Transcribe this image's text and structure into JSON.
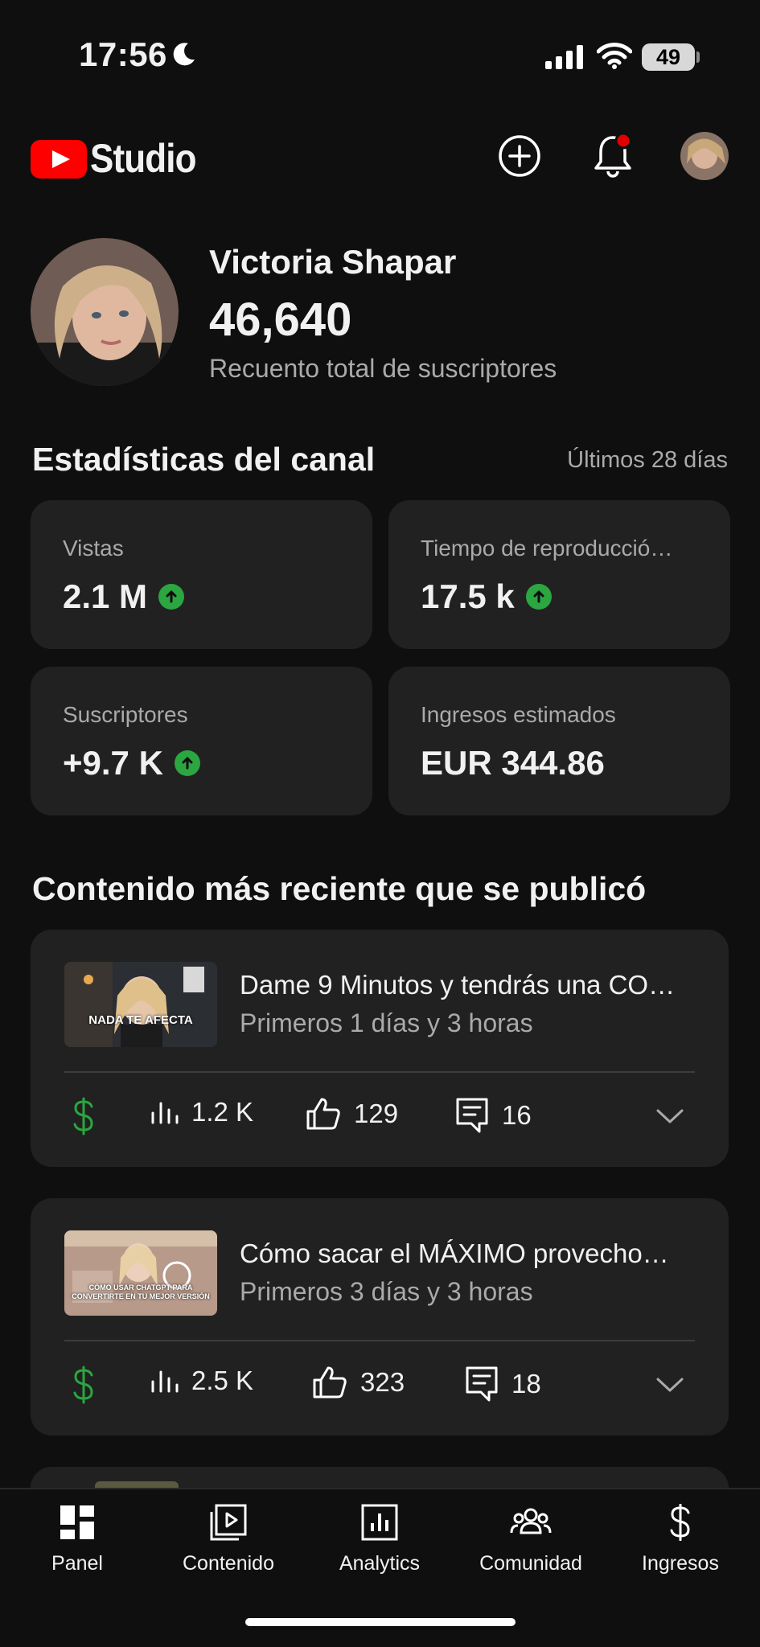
{
  "status_bar": {
    "time": "17:56",
    "battery": "49"
  },
  "header": {
    "brand": "Studio"
  },
  "profile": {
    "name": "Victoria Shapar",
    "subscribers": "46,640",
    "subscribers_label": "Recuento total de suscriptores"
  },
  "stats": {
    "title": "Estadísticas del canal",
    "period": "Últimos 28 días",
    "cards": [
      {
        "label": "Vistas",
        "value": "2.1 M",
        "trend": "up"
      },
      {
        "label": "Tiempo de reproducció…",
        "value": "17.5 k",
        "trend": "up"
      },
      {
        "label": "Suscriptores",
        "value": "+9.7 K",
        "trend": "up"
      },
      {
        "label": "Ingresos estimados",
        "value": "EUR 344.86",
        "trend": "none"
      }
    ]
  },
  "recent": {
    "title": "Contenido más reciente que se publicó",
    "videos": [
      {
        "title": "Dame 9 Minutos y tendrás una CO…",
        "subtitle": "Primeros 1 días y 3 horas",
        "thumb_caption": "NADA TE AFECTA",
        "views": "1.2 K",
        "likes": "129",
        "comments": "16"
      },
      {
        "title": "Cómo sacar el MÁXIMO provecho…",
        "subtitle": "Primeros 3 días y 3 horas",
        "thumb_caption": "CÓMO USAR CHATGPT PARA CONVERTIRTE EN TU MEJOR VERSIÓN",
        "views": "2.5 K",
        "likes": "323",
        "comments": "18"
      }
    ]
  },
  "nav": [
    {
      "label": "Panel",
      "icon": "dashboard-icon"
    },
    {
      "label": "Contenido",
      "icon": "content-icon"
    },
    {
      "label": "Analytics",
      "icon": "analytics-icon"
    },
    {
      "label": "Comunidad",
      "icon": "community-icon"
    },
    {
      "label": "Ingresos",
      "icon": "dollar-icon"
    }
  ],
  "colors": {
    "background": "#0f0f0f",
    "card": "#212121",
    "accent_red": "#ff0000",
    "trend_green": "#2ba640",
    "monetization_green": "#2ba640",
    "secondary_text": "#aaaaaa"
  }
}
